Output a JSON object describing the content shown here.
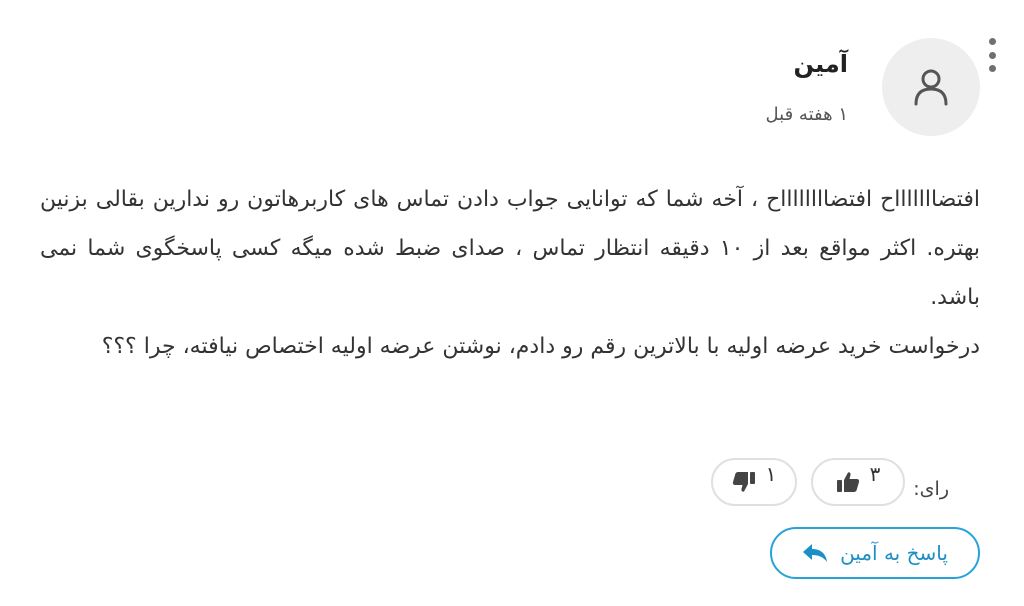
{
  "comment": {
    "author": "آمین",
    "time": "۱ هفته قبل",
    "paragraphs": [
      "افتضاااااااح افتضااااااااح ، آخه شما که توانایی جواب دادن تماس های کاربرهاتون رو ندارین بقالی بزنین بهتره. اکثر مواقع بعد از ۱۰ دقیقه انتظار تماس ، صدای ضبط شده میگه کسی پاسخگوی شما نمی باشد.",
      "درخواست خرید عرضه اولیه با بالاترین رقم رو دادم، نوشتن عرضه اولیه اختصاص نیافته، چرا ؟؟؟"
    ],
    "votes": {
      "label": "رای:",
      "up": "۳",
      "down": "۱"
    },
    "reply_label": "پاسخ به آمین"
  },
  "icons": {
    "menu": "more-vertical-icon",
    "avatar": "user-icon",
    "up": "thumbs-up-icon",
    "down": "thumbs-down-icon",
    "reply": "reply-arrow-icon"
  },
  "colors": {
    "accent": "#27a3d9",
    "accent_text": "#1c8fc6",
    "avatar_bg": "#eeeeee",
    "border": "#e0e0e0"
  }
}
